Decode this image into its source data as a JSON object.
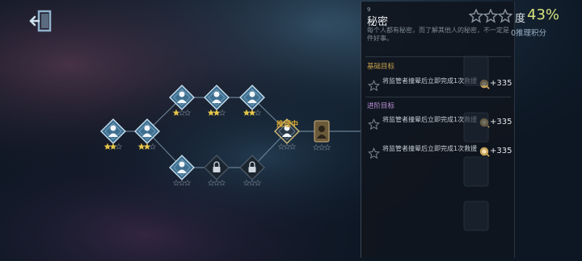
{
  "map": {
    "stars": {
      "filled": "#e6c54a",
      "empty": "#5f6c78"
    },
    "current_label": "推理中",
    "nodes": [
      {
        "kind": "figure",
        "state": "done",
        "stars_earned": 2
      },
      {
        "kind": "figure",
        "state": "done",
        "stars_earned": 2
      },
      {
        "kind": "figure",
        "state": "done",
        "stars_earned": 1
      },
      {
        "kind": "figure",
        "state": "done",
        "stars_earned": 2
      },
      {
        "kind": "figure",
        "state": "done",
        "stars_earned": 2
      },
      {
        "kind": "figure",
        "state": "unlocked",
        "stars_earned": 0
      },
      {
        "kind": "lock",
        "state": "locked",
        "stars_earned": 0
      },
      {
        "kind": "lock",
        "state": "locked",
        "stars_earned": 0
      },
      {
        "kind": "figure",
        "state": "current",
        "stars_earned": 0
      },
      {
        "kind": "card",
        "state": "next",
        "stars_earned": 0
      }
    ]
  },
  "panel": {
    "chapter_mark": "9",
    "title": "秘密",
    "description": "每个人都有秘密，而了解其他人的秘密，不一定是件好事。",
    "basic_label": "基础目标",
    "advanced_label": "进阶目标",
    "goals": [
      {
        "text": "将监管者撞晕后立即完成1次救援",
        "points": "+335",
        "achieved": false
      },
      {
        "text": "将监管者撞晕后立即完成1次救援",
        "points": "+335",
        "achieved": false
      },
      {
        "text": "将监管者撞晕后立即完成1次救援",
        "points": "+335",
        "achieved": false
      }
    ]
  },
  "header": {
    "stars_earned": 0,
    "progress_prefix": "度",
    "progress": "43%",
    "subtitle": "0推理积分"
  }
}
